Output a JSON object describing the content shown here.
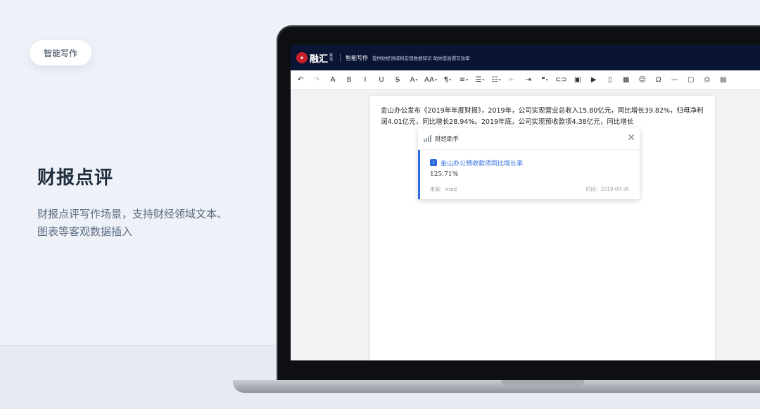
{
  "pill": {
    "label": "智能写作"
  },
  "hero": {
    "title": "财报点评",
    "description": "财报点评写作场景，支持财经领域文本、图表等客观数据插入"
  },
  "app": {
    "logo_text": "融汇",
    "logo_sub": "资讯",
    "title": "智能写作",
    "slogan": "提供财经领域和宏观数据知识 助你提高撰写效率"
  },
  "toolbar": [
    {
      "name": "undo-icon",
      "glyph": "↶",
      "light": false
    },
    {
      "name": "redo-icon",
      "glyph": "↷",
      "light": true
    },
    {
      "name": "clear-format-icon",
      "glyph": "A̶",
      "light": false
    },
    {
      "name": "bold-icon",
      "glyph": "B",
      "light": false
    },
    {
      "name": "italic-icon",
      "glyph": "I",
      "light": false
    },
    {
      "name": "underline-icon",
      "glyph": "U",
      "light": false
    },
    {
      "name": "strikethrough-icon",
      "glyph": "S̶",
      "light": false
    },
    {
      "name": "font-color-icon",
      "glyph": "A",
      "light": false,
      "dd": true
    },
    {
      "name": "font-size-icon",
      "glyph": "AA",
      "light": false,
      "dd": true
    },
    {
      "name": "paragraph-icon",
      "glyph": "¶",
      "light": false,
      "dd": true
    },
    {
      "name": "align-icon",
      "glyph": "≡",
      "light": false,
      "dd": true
    },
    {
      "name": "ordered-list-icon",
      "glyph": "☰",
      "light": false,
      "dd": true
    },
    {
      "name": "bullet-list-icon",
      "glyph": "☷",
      "light": false,
      "dd": true
    },
    {
      "name": "outdent-icon",
      "glyph": "⇤",
      "light": true
    },
    {
      "name": "indent-icon",
      "glyph": "⇥",
      "light": false
    },
    {
      "name": "quote-icon",
      "glyph": "❝",
      "light": false,
      "dd": true
    },
    {
      "name": "link-icon",
      "glyph": "⊂⊃",
      "light": false
    },
    {
      "name": "image-icon",
      "glyph": "▣",
      "light": false
    },
    {
      "name": "video-icon",
      "glyph": "▶",
      "light": false
    },
    {
      "name": "file-icon",
      "glyph": "▯",
      "light": false
    },
    {
      "name": "table-icon",
      "glyph": "▦",
      "light": false
    },
    {
      "name": "emoji-icon",
      "glyph": "☺",
      "light": false
    },
    {
      "name": "special-char-icon",
      "glyph": "Ω",
      "light": false
    },
    {
      "name": "horizontal-rule-icon",
      "glyph": "—",
      "light": false
    },
    {
      "name": "code-icon",
      "glyph": "▢",
      "light": false
    },
    {
      "name": "print-icon",
      "glyph": "⎙",
      "light": false
    },
    {
      "name": "export-icon",
      "glyph": "▤",
      "light": false
    }
  ],
  "document": {
    "text": "金山办公发布《2019年年度财报》，2019年，公司实现营业总收入15.80亿元，同比增长39.82%，归母净利润4.01亿元，同比增长28.94%。2019年底，公司实现预收款项4.38亿元，同比增长"
  },
  "assistant": {
    "title": "财经助手",
    "card": {
      "badge": "i",
      "title": "金山办公预收款项同比增长率",
      "value": "125.71%",
      "source": "来源：wind",
      "time": "时间：2019-09-30"
    }
  },
  "colors": {
    "accent": "#2f6bde",
    "header_bg": "#0a1433",
    "logo_red": "#c8202a"
  }
}
